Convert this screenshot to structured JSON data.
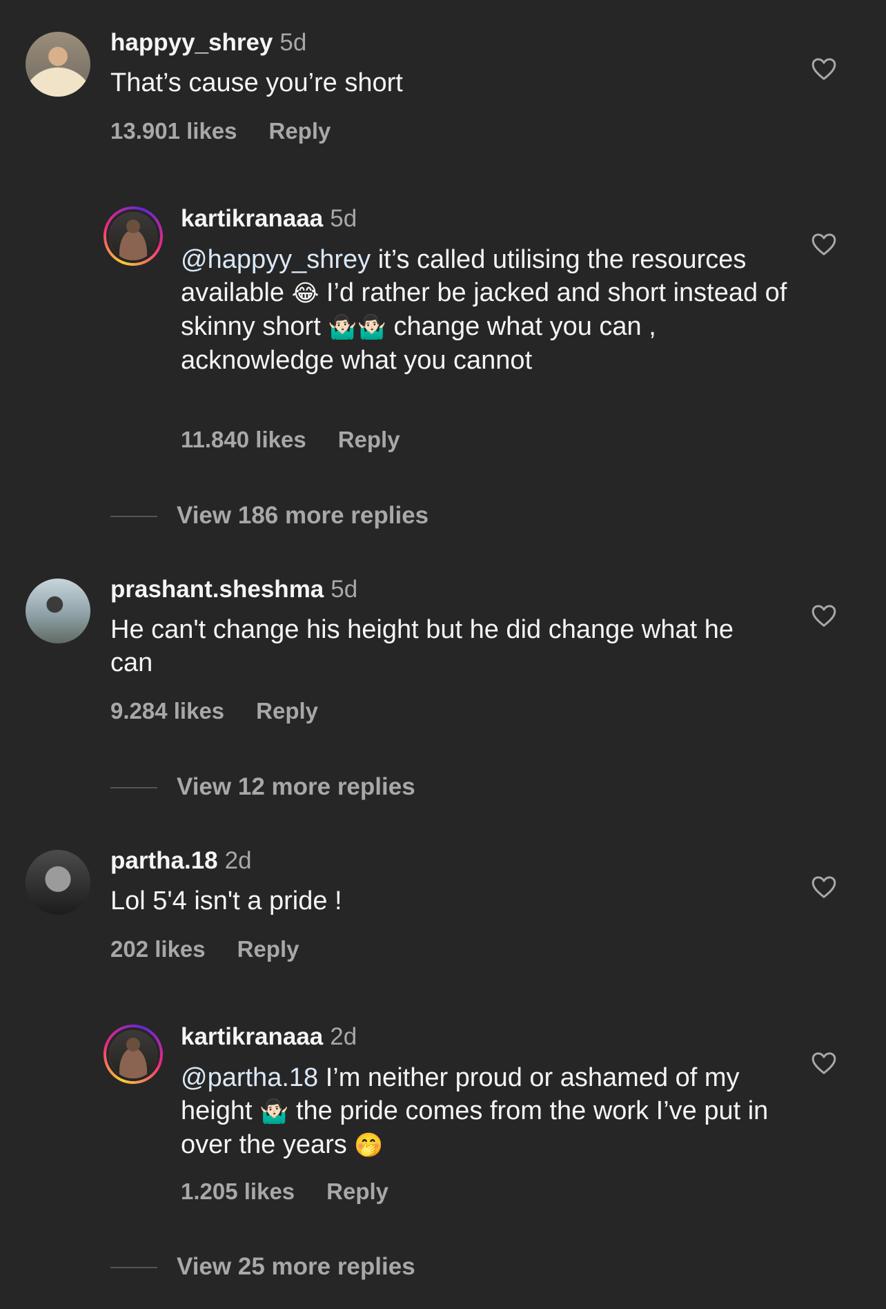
{
  "comments": [
    {
      "username": "happyy_shrey",
      "time": "5d",
      "text": "That’s cause you’re short",
      "likes": "13.901 likes",
      "reply": "Reply"
    },
    {
      "username": "kartikranaaa",
      "time": "5d",
      "mention": "@happyy_shrey",
      "text_a": " it’s called utilising the resources available ",
      "emoji_a": "😂",
      "text_b": " I’d rather be jacked and short instead of skinny short ",
      "emoji_b": "🤷🏻‍♂️🤷🏻‍♂️",
      "text_c": " change what you can , acknowledge what you cannot",
      "likes": "11.840 likes",
      "reply": "Reply"
    },
    {
      "view_more": "View 186 more replies"
    },
    {
      "username": "prashant.sheshma",
      "time": "5d",
      "text": "He can't change his height but he did change what he can",
      "likes": "9.284 likes",
      "reply": "Reply"
    },
    {
      "view_more": "View 12 more replies"
    },
    {
      "username": "partha.18",
      "time": "2d",
      "text": "Lol 5'4 isn't a pride !",
      "likes": "202 likes",
      "reply": "Reply"
    },
    {
      "username": "kartikranaaa",
      "time": "2d",
      "mention": "@partha.18",
      "text_a": " I’m neither proud or ashamed of my height ",
      "emoji_a": "🤷🏻‍♂️",
      "text_b": " the pride comes from the work I’ve put in over the years ",
      "emoji_b": "🤭",
      "likes": "1.205 likes",
      "reply": "Reply"
    },
    {
      "view_more": "View 25 more replies"
    }
  ],
  "icons": {
    "heart": "heart-outline-icon"
  }
}
